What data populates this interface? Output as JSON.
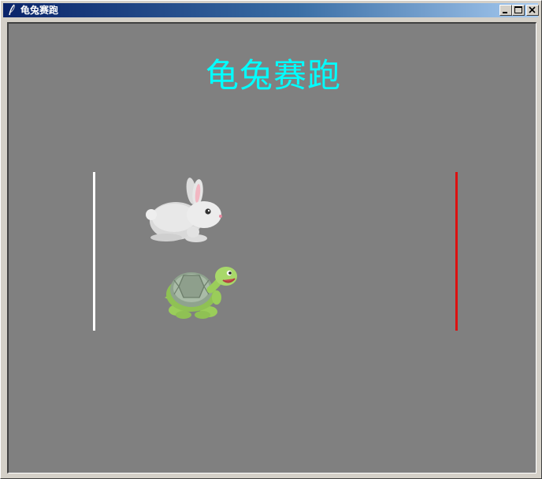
{
  "window": {
    "title": "龟兔赛跑",
    "app_icon": "feather-icon",
    "controls": [
      "minimize-icon",
      "maximize-icon",
      "close-icon"
    ]
  },
  "game": {
    "title": "龟兔赛跑",
    "title_color": "#00ffff",
    "background_color": "#808080",
    "start_line_color": "#ffffff",
    "finish_line_color": "#dd1111",
    "racers": [
      "rabbit",
      "turtle"
    ]
  }
}
